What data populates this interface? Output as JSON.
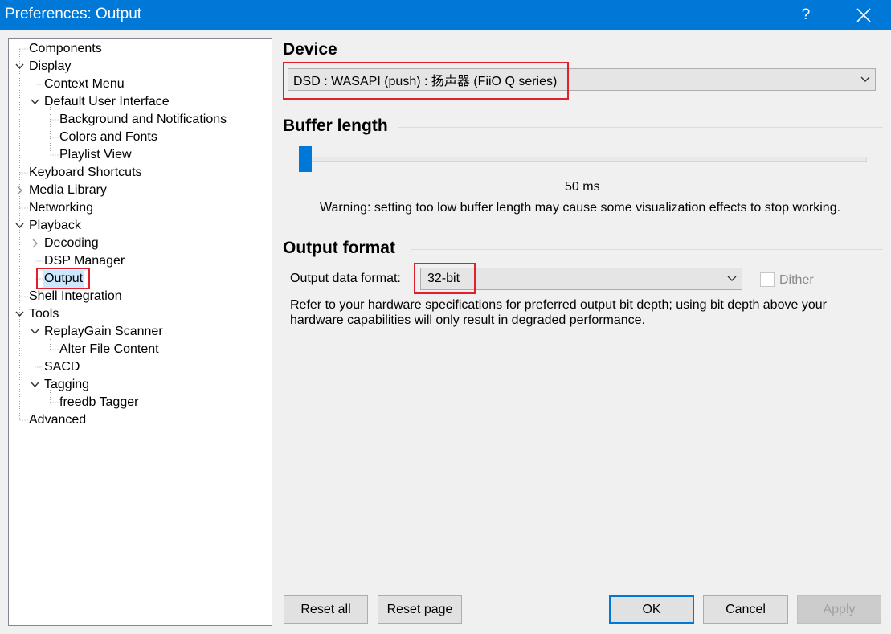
{
  "window": {
    "title": "Preferences: Output",
    "help_label": "?"
  },
  "tree": {
    "items": [
      {
        "label": "Components"
      },
      {
        "label": "Display"
      },
      {
        "label": "Context Menu"
      },
      {
        "label": "Default User Interface"
      },
      {
        "label": "Background and Notifications"
      },
      {
        "label": "Colors and Fonts"
      },
      {
        "label": "Playlist View"
      },
      {
        "label": "Keyboard Shortcuts"
      },
      {
        "label": "Media Library"
      },
      {
        "label": "Networking"
      },
      {
        "label": "Playback"
      },
      {
        "label": "Decoding"
      },
      {
        "label": "DSP Manager"
      },
      {
        "label": "Output"
      },
      {
        "label": "Shell Integration"
      },
      {
        "label": "Tools"
      },
      {
        "label": "ReplayGain Scanner"
      },
      {
        "label": "Alter File Content"
      },
      {
        "label": "SACD"
      },
      {
        "label": "Tagging"
      },
      {
        "label": "freedb Tagger"
      },
      {
        "label": "Advanced"
      }
    ]
  },
  "device": {
    "title": "Device",
    "selected": "DSD : WASAPI (push) : 扬声器 (FiiO Q series)"
  },
  "buffer": {
    "title": "Buffer length",
    "value_text": "50 ms",
    "slider_fraction": 0.0,
    "warning": "Warning: setting too low buffer length may cause some visualization effects to stop working."
  },
  "output_format": {
    "title": "Output format",
    "label": "Output data format:",
    "selected": "32-bit",
    "dither_label": "Dither",
    "dither_checked": false,
    "note_line1": "Refer to your hardware specifications for preferred output bit depth; using bit depth above your",
    "note_line2": "hardware capabilities will only result in degraded performance."
  },
  "buttons": {
    "reset_all": "Reset all",
    "reset_page": "Reset page",
    "ok": "OK",
    "cancel": "Cancel",
    "apply": "Apply"
  },
  "colors": {
    "titlebar": "#0078d7",
    "highlight": "#e0202a",
    "selection": "#cce8ff",
    "slider": "#0078d7"
  }
}
